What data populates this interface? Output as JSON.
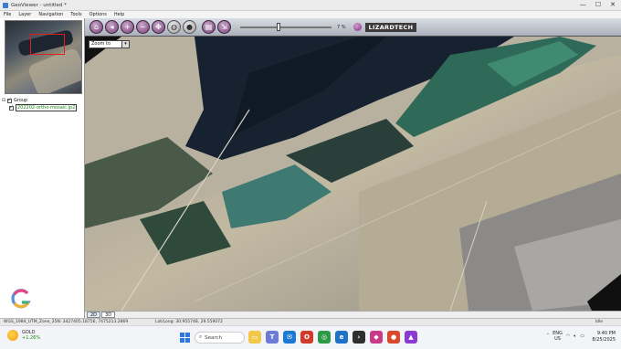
{
  "window": {
    "title": "GeoViewer - untitled *",
    "controls": [
      "—",
      "☐",
      "✕"
    ]
  },
  "menu": [
    "File",
    "Layer",
    "Navigation",
    "Tools",
    "Options",
    "Help"
  ],
  "layers": {
    "group_label": "Group",
    "child_label": "202202-ortho-mosaic.jp2"
  },
  "toolbar": {
    "buttons": [
      "home-icon",
      "back-icon",
      "zoom-in-icon",
      "zoom-out-icon",
      "pan-icon",
      "globe-icon",
      "full-extent-icon",
      "print-icon",
      "export-icon"
    ],
    "zoom_percent": "7 %",
    "zoom_level": 0.42,
    "brand": "LIZARDTECH"
  },
  "map": {
    "zoom_to_label": "Zoom to"
  },
  "view_tabs": [
    "2D",
    "3D"
  ],
  "status": {
    "crs": "WGS_1984_UTM_Zone_35N: 3427405.18756, 7475213.2869",
    "latlong": "Lat/Long: 30.955748, 29.559072",
    "state": "Idle"
  },
  "taskbar": {
    "weather_index": "GOLD",
    "weather_change": "+1.26%",
    "search_placeholder": "Search",
    "tray_lang_1": "ENG",
    "tray_lang_2": "US",
    "time": "9:40 PM",
    "date": "8/25/2025"
  },
  "colors": {
    "toolbar_button": "#7a3f7a",
    "start_blue": "#2b78e4",
    "layer_green": "#1a8a1a"
  }
}
